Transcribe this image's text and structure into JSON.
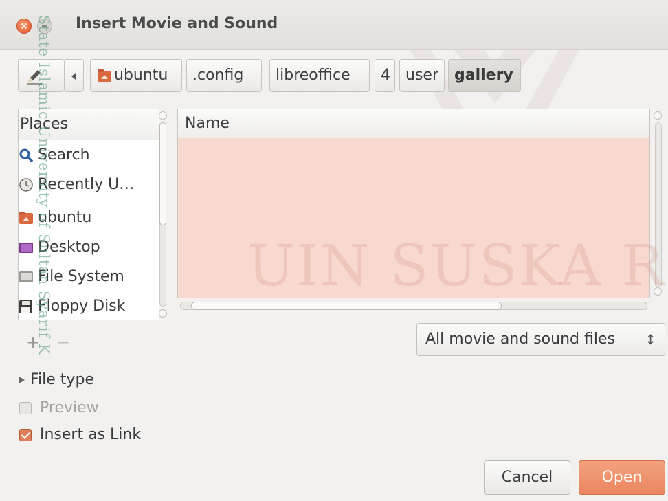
{
  "window": {
    "title": "Insert Movie and Sound"
  },
  "pathbar": {
    "crumbs": [
      "ubuntu",
      ".config",
      "libreoffice",
      "4",
      "user",
      "gallery"
    ],
    "active": "gallery"
  },
  "places": {
    "header": "Places",
    "items": [
      {
        "label": "Search",
        "icon": "search-icon"
      },
      {
        "label": "Recently U…",
        "icon": "recent-icon"
      },
      {
        "label": "ubuntu",
        "icon": "home-folder-icon"
      },
      {
        "label": "Desktop",
        "icon": "desktop-icon"
      },
      {
        "label": "File System",
        "icon": "drive-icon"
      },
      {
        "label": "Floppy Disk",
        "icon": "floppy-icon"
      }
    ],
    "add_label": "+",
    "remove_label": "−"
  },
  "filelist": {
    "column_name": "Name",
    "rows": []
  },
  "filter": {
    "selected": "All movie and sound files",
    "arrows": "↕"
  },
  "options": {
    "file_type_label": "File type",
    "preview_label": "Preview",
    "preview_checked": false,
    "insert_link_label": "Insert as Link",
    "insert_link_checked": true
  },
  "actions": {
    "cancel_label": "Cancel",
    "open_label": "Open"
  },
  "watermark": {
    "main": "UIN SUSKA RI",
    "side": "State Islamic University of Sultan Syarif K"
  },
  "colors": {
    "accent": "#e9855f",
    "filelist_bg": "#f8d9cf"
  }
}
